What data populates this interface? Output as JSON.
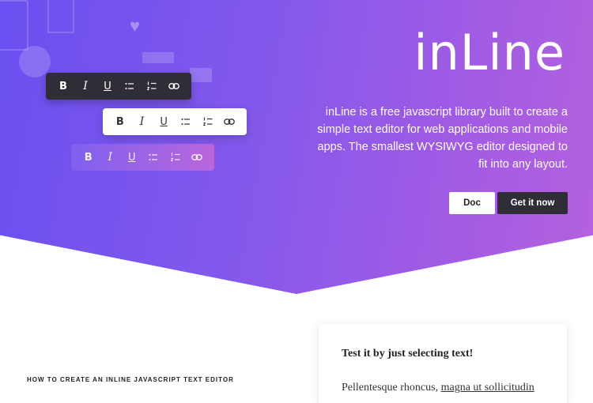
{
  "hero": {
    "logo": "inLine",
    "description": "inLine is a free javascript library built to create a simple text editor for web applications and mobile apps. The smallest WYSIWYG editor designed to fit into any layout.",
    "doc_button": "Doc",
    "get_button": "Get it now",
    "colors": {
      "gradient_start": "#6b4ff0",
      "gradient_end": "#b562dd",
      "dark": "#2f2d35"
    }
  },
  "toolbars": [
    {
      "style": "dark",
      "tools": [
        "bold-icon",
        "italic-icon",
        "underline-icon",
        "bullet-list-icon",
        "numbered-list-icon",
        "link-icon"
      ]
    },
    {
      "style": "light",
      "tools": [
        "bold-icon",
        "italic-icon",
        "underline-icon",
        "bullet-list-icon",
        "numbered-list-icon",
        "link-icon"
      ]
    },
    {
      "style": "glass",
      "tools": [
        "bold-icon",
        "italic-icon",
        "underline-icon",
        "bullet-list-icon",
        "numbered-list-icon",
        "link-icon"
      ]
    }
  ],
  "glyphs": {
    "bold": "B",
    "italic": "I",
    "underline": "U"
  },
  "section": {
    "heading": "HOW TO CREATE AN INLINE JAVASCRIPT TEXT EDITOR"
  },
  "demo": {
    "title": "Test it by just selecting text!",
    "text_plain": "Pellentesque rhoncus, ",
    "text_link": "magna ut sollicitudin"
  }
}
